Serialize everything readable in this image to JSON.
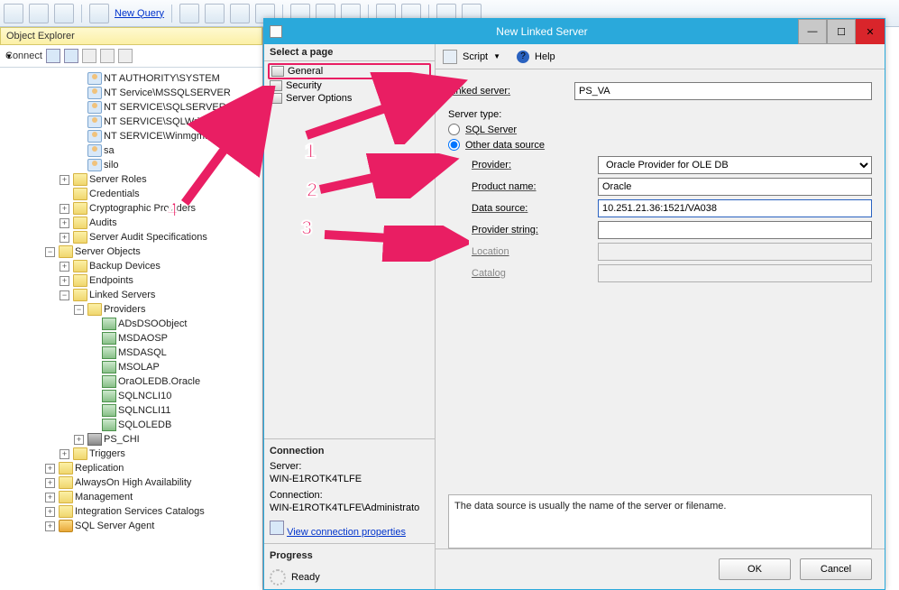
{
  "toolbar": {
    "new_query": "New Query"
  },
  "oe": {
    "title": "Object Explorer",
    "connect": "Connect",
    "tree": {
      "logins": [
        "NT AUTHORITY\\SYSTEM",
        "NT Service\\MSSQLSERVER",
        "NT SERVICE\\SQLSERVERAGEN",
        "NT SERVICE\\SQLWriter",
        "NT SERVICE\\Winmgmt",
        "sa",
        "silo"
      ],
      "server_roles": "Server Roles",
      "credentials": "Credentials",
      "crypto": "Cryptographic Providers",
      "audits": "Audits",
      "audit_spec": "Server Audit Specifications",
      "server_objects": "Server Objects",
      "backup": "Backup Devices",
      "endpoints": "Endpoints",
      "linked_servers": "Linked Servers",
      "providers": "Providers",
      "provider_items": [
        "ADsDSOObject",
        "MSDAOSP",
        "MSDASQL",
        "MSOLAP",
        "OraOLEDB.Oracle",
        "SQLNCLI10",
        "SQLNCLI11",
        "SQLOLEDB"
      ],
      "ps_chi": "PS_CHI",
      "triggers": "Triggers",
      "replication": "Replication",
      "alwayson": "AlwaysOn High Availability",
      "management": "Management",
      "isc": "Integration Services Catalogs",
      "agent": "SQL Server Agent"
    }
  },
  "dialog": {
    "title": "New Linked Server",
    "select_page": "Select a page",
    "pages": [
      "General",
      "Security",
      "Server Options"
    ],
    "script": "Script",
    "help": "Help",
    "labels": {
      "linked_server": "Linked server:",
      "server_type": "Server type:",
      "sql_server": "SQL Server",
      "other": "Other data source",
      "provider": "Provider:",
      "product": "Product name:",
      "data_source": "Data source:",
      "provider_string": "Provider string:",
      "location": "Location",
      "catalog": "Catalog"
    },
    "values": {
      "linked_server": "PS_VA",
      "provider": "Oracle Provider for OLE DB",
      "product": "Oracle",
      "data_source": "10.251.21.36:1521/VA038",
      "provider_string": ""
    },
    "connection": {
      "title": "Connection",
      "server_lbl": "Server:",
      "server": "WIN-E1ROTK4TLFE",
      "conn_lbl": "Connection:",
      "conn": "WIN-E1ROTK4TLFE\\Administrato",
      "view_props": "View connection properties"
    },
    "progress": {
      "title": "Progress",
      "status": "Ready"
    },
    "hint": "The data source is usually the name of the server or filename.",
    "ok": "OK",
    "cancel": "Cancel"
  },
  "annotations": {
    "n1": "1",
    "n2": "2",
    "n3": "3",
    "n4": "4"
  }
}
